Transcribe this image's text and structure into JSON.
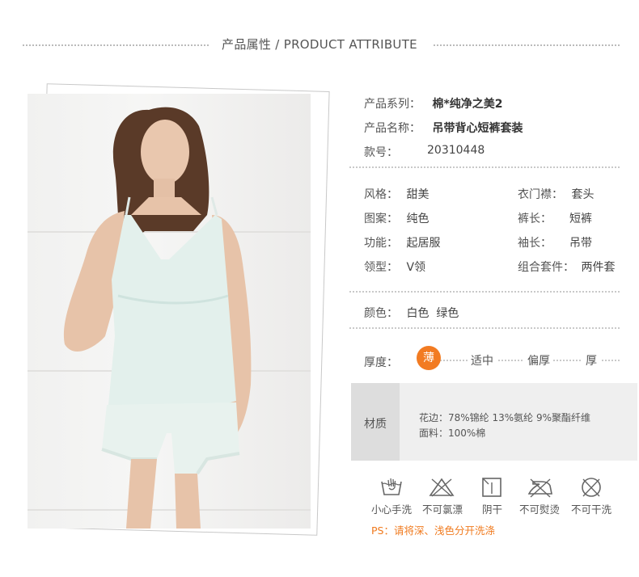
{
  "header": {
    "title": "产品属性 / PRODUCT ATTRIBUTE"
  },
  "basic": {
    "series_label": "产品系列：",
    "series_value": "棉*纯净之美2",
    "name_label": "产品名称：",
    "name_value": "吊带背心短裤套装",
    "sku_label": "款号：",
    "sku_value": "20310448"
  },
  "attrs": {
    "style_label": "风格：",
    "style_value": "甜美",
    "placket_label": "衣门襟：",
    "placket_value": "套头",
    "pattern_label": "图案：",
    "pattern_value": "纯色",
    "pants_len_label": "裤长：",
    "pants_len_value": "短裤",
    "function_label": "功能：",
    "function_value": "起居服",
    "sleeve_label": "袖长：",
    "sleeve_value": "吊带",
    "collar_label": "领型：",
    "collar_value": "V领",
    "set_label": "组合套件：",
    "set_value": "两件套"
  },
  "color": {
    "label": "颜色：",
    "values": "白色  绿色"
  },
  "thickness": {
    "label": "厚度：",
    "options": [
      "薄",
      "适中",
      "偏厚",
      "厚"
    ],
    "selected": "薄",
    "accent": "#f27b22"
  },
  "material": {
    "label": "材质",
    "line1": "花边：78%锦纶 13%氨纶 9%聚酯纤维",
    "line2": "面料：100%棉"
  },
  "care": [
    {
      "icon": "hand-wash-icon",
      "label": "小心手洗"
    },
    {
      "icon": "no-bleach-icon",
      "label": "不可氯漂"
    },
    {
      "icon": "shade-dry-icon",
      "label": "阴干"
    },
    {
      "icon": "no-iron-icon",
      "label": "不可熨烫"
    },
    {
      "icon": "no-dry-clean-icon",
      "label": "不可干洗"
    }
  ],
  "note": "PS：请将深、浅色分开洗涤"
}
